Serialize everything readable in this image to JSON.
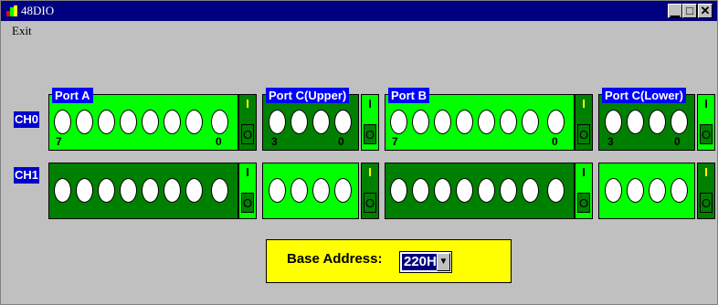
{
  "window": {
    "title": "48DIO",
    "controls": {
      "minimize": "▁",
      "maximize": "□",
      "close": "✕"
    }
  },
  "menu": {
    "items": [
      {
        "label": "Exit"
      }
    ]
  },
  "channels": [
    {
      "label": "CH0",
      "shadow_label": ""
    },
    {
      "label": "CH1",
      "shadow_label": ""
    }
  ],
  "ports": [
    {
      "title": "Port A",
      "ch0_state": "input",
      "ch1_state": "output",
      "bits": 8,
      "msb": "7",
      "lsb": "0"
    },
    {
      "title": "Port C(Upper)",
      "ch0_state": "output",
      "ch1_state": "input",
      "bits": 4,
      "msb": "3",
      "lsb": "0"
    },
    {
      "title": "Port B",
      "ch0_state": "input",
      "ch1_state": "output",
      "bits": 8,
      "msb": "7",
      "lsb": "0"
    },
    {
      "title": "Port C(Lower)",
      "ch0_state": "output",
      "ch1_state": "input",
      "bits": 4,
      "msb": "3",
      "lsb": "0"
    }
  ],
  "io_toggle": {
    "in_label": "I",
    "out_label": "O"
  },
  "base_address": {
    "label": "Base Address:",
    "value": "220H",
    "arrow": "▼"
  },
  "colors": {
    "title_bar": "#000080",
    "port_light": "#00ff00",
    "port_dark": "#008000",
    "port_title": "#0000ff",
    "base_panel": "#ffff00",
    "io_indicator": "#ffff00"
  },
  "icons": {
    "app": "app-icon"
  }
}
